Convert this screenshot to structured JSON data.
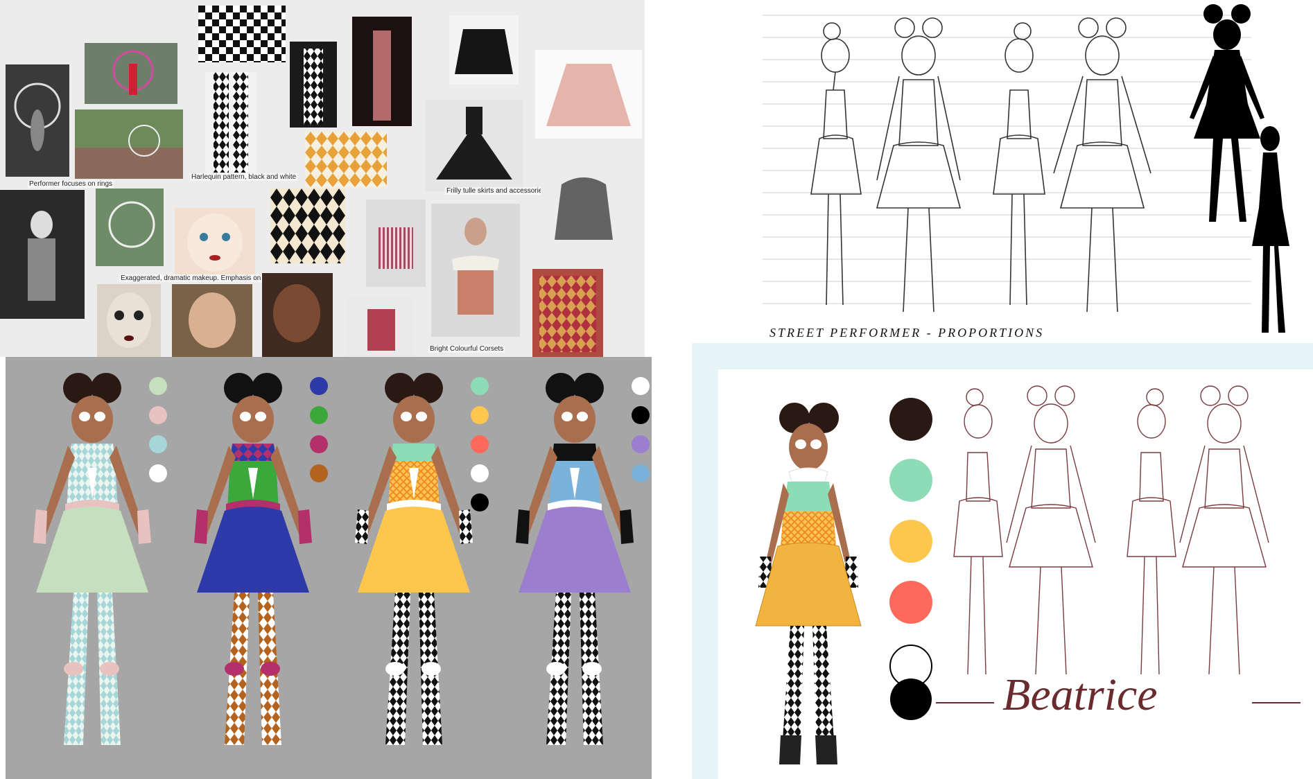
{
  "moodboard": {
    "captions": {
      "rings": "Performer focuses on rings",
      "harlequin": "Harlequin pattern, black and white",
      "tulle": "Frilly tulle skirts and accessories",
      "makeup": "Exaggerated, dramatic makeup. Emphasis on the eyes",
      "corsets": "Bright Colourful Corsets"
    }
  },
  "sheet": {
    "title": "STREET PERFORMER - PROPORTIONS"
  },
  "final": {
    "name": "Beatrice"
  },
  "colors": {
    "background_light": "#ececec",
    "lineup_gray": "#a6a6a6",
    "final_border": "#e6f4f6",
    "skin": "#a86e4e",
    "hair": "#2a1812",
    "name_color": "#6a2a2e",
    "variant1_palette": [
      "#c6dfbf",
      "#e8c2c0",
      "#a6d6d8",
      "#ffffff"
    ],
    "variant2_palette": [
      "#2e3aa8",
      "#3aa83a",
      "#b3306a",
      "#b3631e"
    ],
    "variant3_palette": [
      "#8ddcb5",
      "#fdc64d",
      "#fd6a5c",
      "#ffffff",
      "#000000"
    ],
    "variant4_palette": [
      "#ffffff",
      "#000000",
      "#9c7ecf",
      "#7bb2da"
    ],
    "final_palette": [
      "#2a1812",
      "#8ddcb5",
      "#fdc64d",
      "#fd6a5c"
    ]
  }
}
